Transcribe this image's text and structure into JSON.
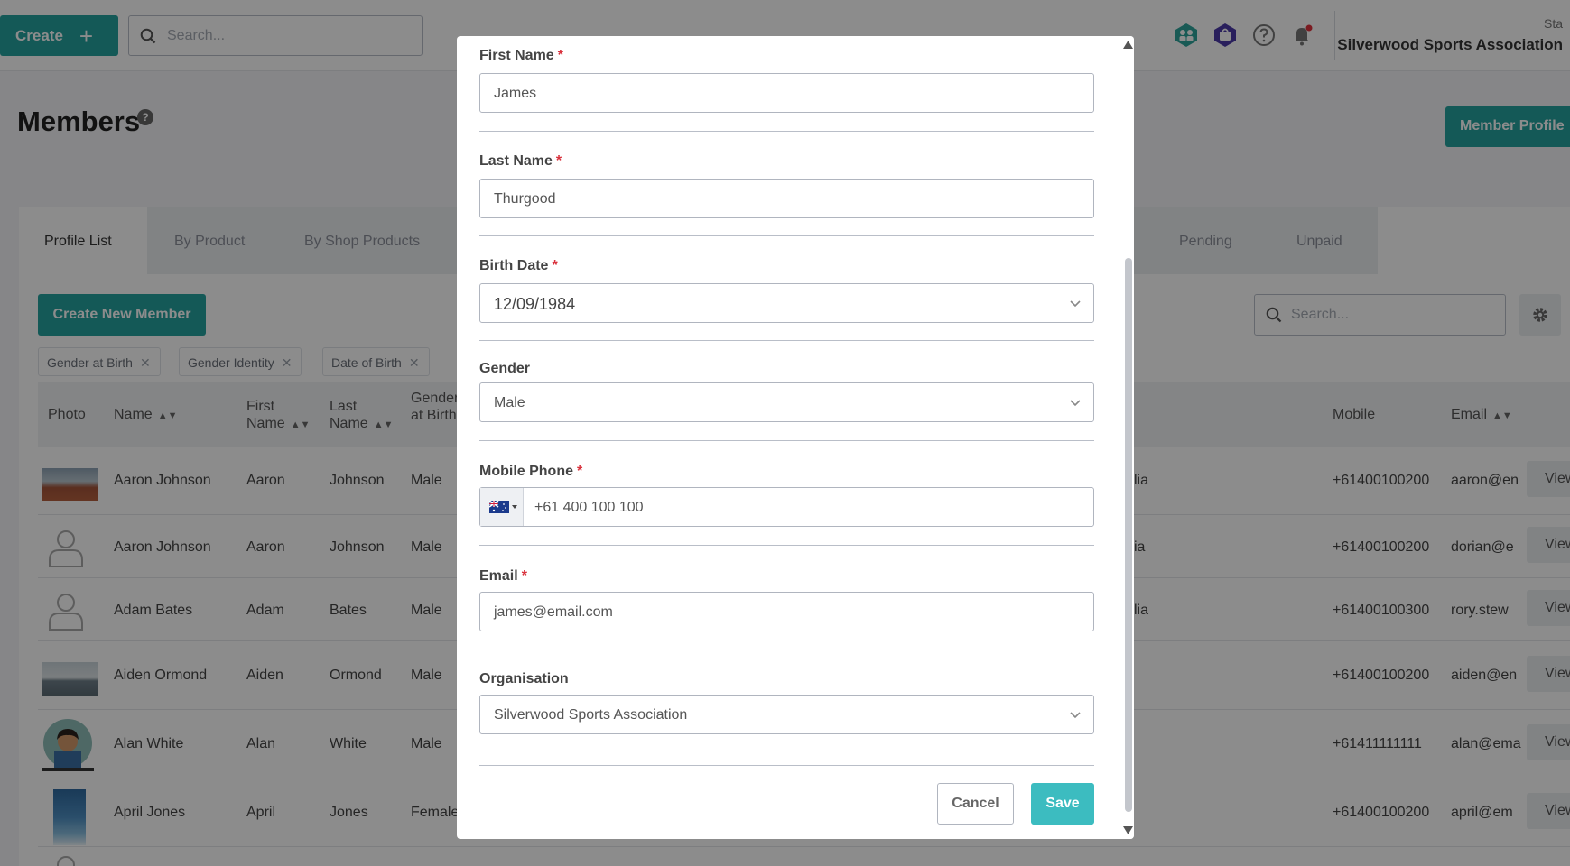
{
  "topbar": {
    "create_label": "Create",
    "create_plus": "+",
    "search_placeholder": "Search...",
    "org_label": "Sta",
    "org_name": "Silverwood Sports Association"
  },
  "page": {
    "title": "Members",
    "help": "?",
    "member_profile_btn": "Member Profile"
  },
  "tabs": [
    "Profile List",
    "By Product",
    "By Shop Products",
    "Pending",
    "Unpaid"
  ],
  "toolbar": {
    "create_member": "Create New Member",
    "search_placeholder": "Search..."
  },
  "filters": [
    "Gender at Birth",
    "Gender Identity",
    "Date of Birth"
  ],
  "table": {
    "headers": {
      "photo": "Photo",
      "name": "Name",
      "first": "First Name",
      "last": "Last Name",
      "gender": "Gender at Birth",
      "mobile": "Mobile",
      "email": "Email"
    },
    "rows": [
      {
        "name": "Aaron Johnson",
        "first": "Aaron",
        "last": "Johnson",
        "gender": "Male",
        "country": "lia",
        "mobile": "+61400100200",
        "email": "aaron@en",
        "view": "View"
      },
      {
        "name": "Aaron Johnson",
        "first": "Aaron",
        "last": "Johnson",
        "gender": "Male",
        "country": "ia",
        "mobile": "+61400100200",
        "email": "dorian@e",
        "view": "View"
      },
      {
        "name": "Adam Bates",
        "first": "Adam",
        "last": "Bates",
        "gender": "Male",
        "country": "lia",
        "mobile": "+61400100300",
        "email": "rory.stew",
        "view": "View"
      },
      {
        "name": "Aiden Ormond",
        "first": "Aiden",
        "last": "Ormond",
        "gender": "Male",
        "country": "",
        "mobile": "+61400100200",
        "email": "aiden@en",
        "view": "View"
      },
      {
        "name": "Alan White",
        "first": "Alan",
        "last": "White",
        "gender": "Male",
        "country": "",
        "mobile": "+61411111111",
        "email": "alan@ema",
        "view": "View"
      },
      {
        "name": "April Jones",
        "first": "April",
        "last": "Jones",
        "gender": "Female",
        "country": "",
        "mobile": "+61400100200",
        "email": "april@em",
        "view": "View"
      }
    ]
  },
  "modal": {
    "first_name": {
      "label": "First Name",
      "value": "James",
      "required": "*"
    },
    "last_name": {
      "label": "Last Name",
      "value": "Thurgood",
      "required": "*"
    },
    "birth_date": {
      "label": "Birth Date",
      "value": "12/09/1984",
      "required": "*"
    },
    "gender": {
      "label": "Gender",
      "value": "Male"
    },
    "mobile": {
      "label": "Mobile Phone",
      "value": "+61 400 100 100",
      "required": "*"
    },
    "email": {
      "label": "Email",
      "value": "james@email.com",
      "required": "*"
    },
    "organisation": {
      "label": "Organisation",
      "value": "Silverwood Sports Association"
    },
    "cancel": "Cancel",
    "save": "Save"
  },
  "colors": {
    "primary": "#26a29e",
    "save": "#3cbcc0",
    "required": "#d9313c"
  }
}
